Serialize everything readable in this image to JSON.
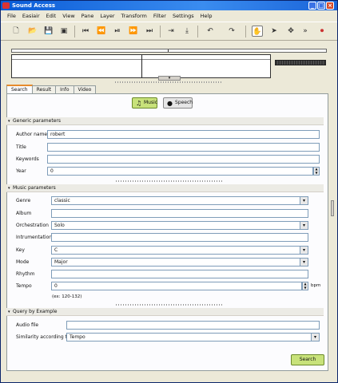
{
  "window": {
    "title": "Sound Access"
  },
  "menu": [
    "File",
    "Easiair",
    "Edit",
    "View",
    "Pane",
    "Layer",
    "Transform",
    "Filter",
    "Settings",
    "Help"
  ],
  "tabs": [
    "Search",
    "Result",
    "Info",
    "Video"
  ],
  "mode": {
    "music": "Music",
    "speech": "Speech"
  },
  "generic": {
    "header": "Generic parameters",
    "author_label": "Author name",
    "author_value": "robert",
    "title_label": "Title",
    "title_value": "",
    "keywords_label": "Keywords",
    "keywords_value": "",
    "year_label": "Year",
    "year_value": "0"
  },
  "music": {
    "header": "Music parameters",
    "genre_label": "Genre",
    "genre_value": "classic",
    "album_label": "Album",
    "album_value": "",
    "orchestration_label": "Orchestration",
    "orchestration_value": "Solo",
    "instrumentation_label": "Intrumentation",
    "instrumentation_value": "",
    "key_label": "Key",
    "key_value": "C",
    "mode_label": "Mode",
    "mode_value": "Major",
    "rhythm_label": "Rhythm",
    "rhythm_value": "",
    "tempo_label": "Tempo",
    "tempo_value": "0",
    "tempo_unit": "bpm",
    "tempo_hint": "(ex: 120-132)"
  },
  "qbe": {
    "header": "Query by Example",
    "audio_label": "Audio file",
    "audio_value": "",
    "similarity_label": "Similarity according to",
    "similarity_value": "Tempo"
  },
  "search_button": "Search",
  "colors": {
    "accent_green": "#c8e27a",
    "title_blue": "#0a5bd6"
  }
}
